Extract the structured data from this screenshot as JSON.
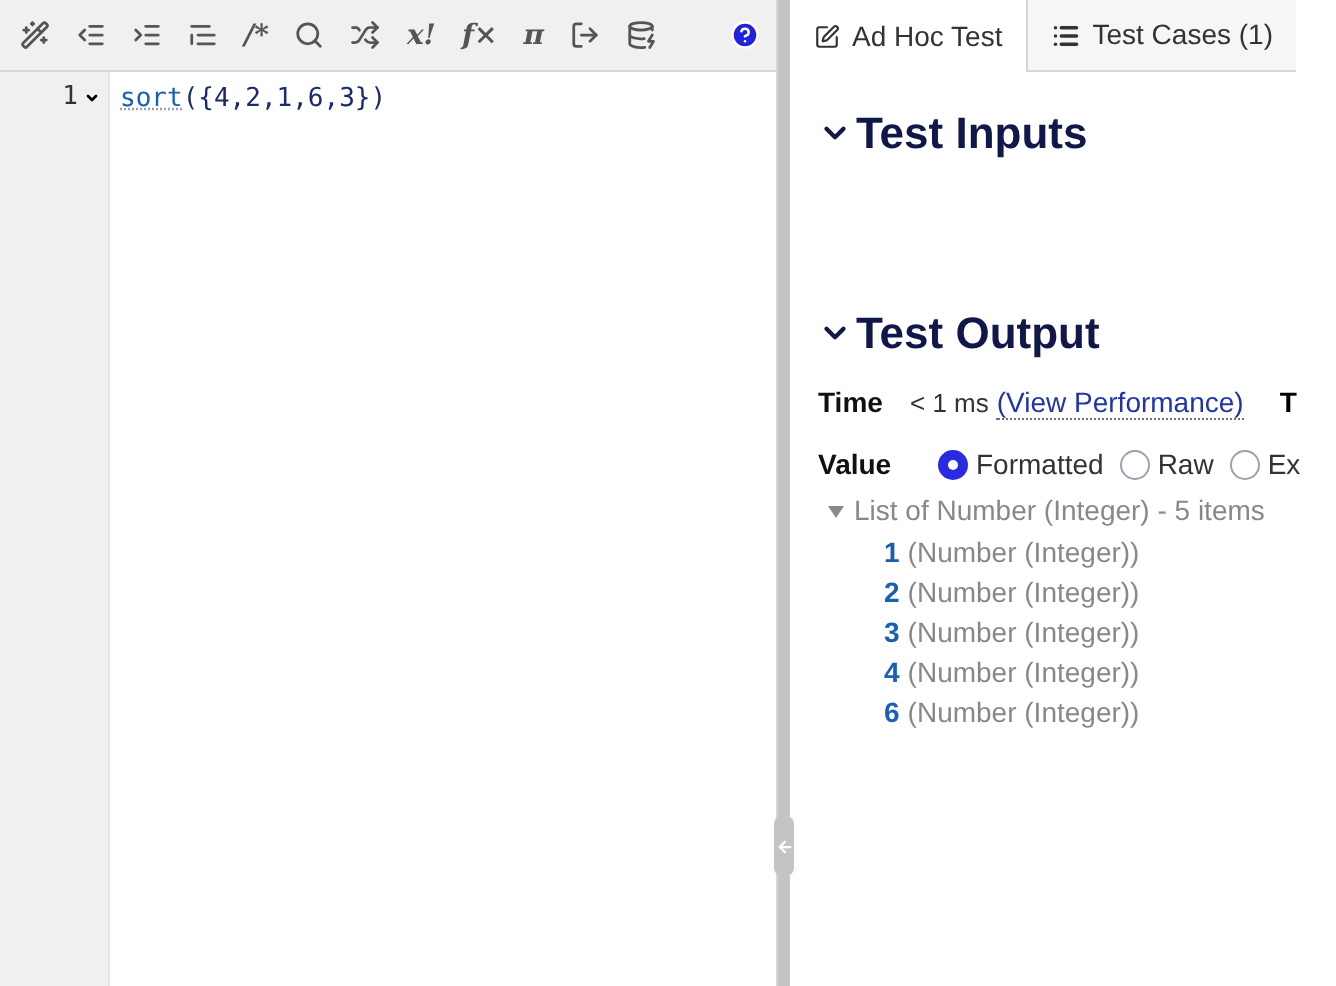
{
  "toolbar": [
    {
      "kind": "icon"
    },
    {
      "kind": "icon"
    },
    {
      "kind": "icon"
    },
    {
      "kind": "icon"
    },
    {
      "kind": "glyph",
      "text": "/*"
    },
    {
      "kind": "icon"
    },
    {
      "kind": "icon"
    },
    {
      "kind": "glyph",
      "text": "x!"
    },
    {
      "kind": "glyph",
      "text": "f×"
    },
    {
      "kind": "glyph",
      "text": "π"
    },
    {
      "kind": "icon"
    },
    {
      "kind": "icon"
    }
  ],
  "editor": {
    "lines": [
      {
        "number": "1",
        "folded": false,
        "tokens": [
          {
            "kind": "function",
            "text": "sort"
          },
          {
            "kind": "plain",
            "text": "({4,2,1,6,3})"
          }
        ]
      }
    ]
  },
  "tabs": [
    {
      "label": "Ad Hoc Test",
      "selected": true
    },
    {
      "label": "Test Cases (1)",
      "selected": false
    }
  ],
  "sections": [
    {
      "title": "Test Inputs",
      "expanded": true
    },
    {
      "title": "Test Output",
      "expanded": true
    }
  ],
  "output": {
    "time_label": "Time",
    "time_value": "< 1 ms",
    "time_link": "(View Performance)",
    "column_3": "T",
    "value_label": "Value",
    "formats": [
      {
        "label": "Formatted",
        "selected": true
      },
      {
        "label": "Raw",
        "selected": false
      },
      {
        "label": "Ex",
        "selected": false
      }
    ],
    "tree": {
      "label": "List of Number (Integer) - 5 items",
      "expanded": true,
      "children": [
        {
          "value": "1",
          "type": "(Number (Integer))"
        },
        {
          "value": "2",
          "type": "(Number (Integer))"
        },
        {
          "value": "3",
          "type": "(Number (Integer))"
        },
        {
          "value": "4",
          "type": "(Number (Integer))"
        },
        {
          "value": "6",
          "type": "(Number (Integer))"
        }
      ]
    }
  }
}
